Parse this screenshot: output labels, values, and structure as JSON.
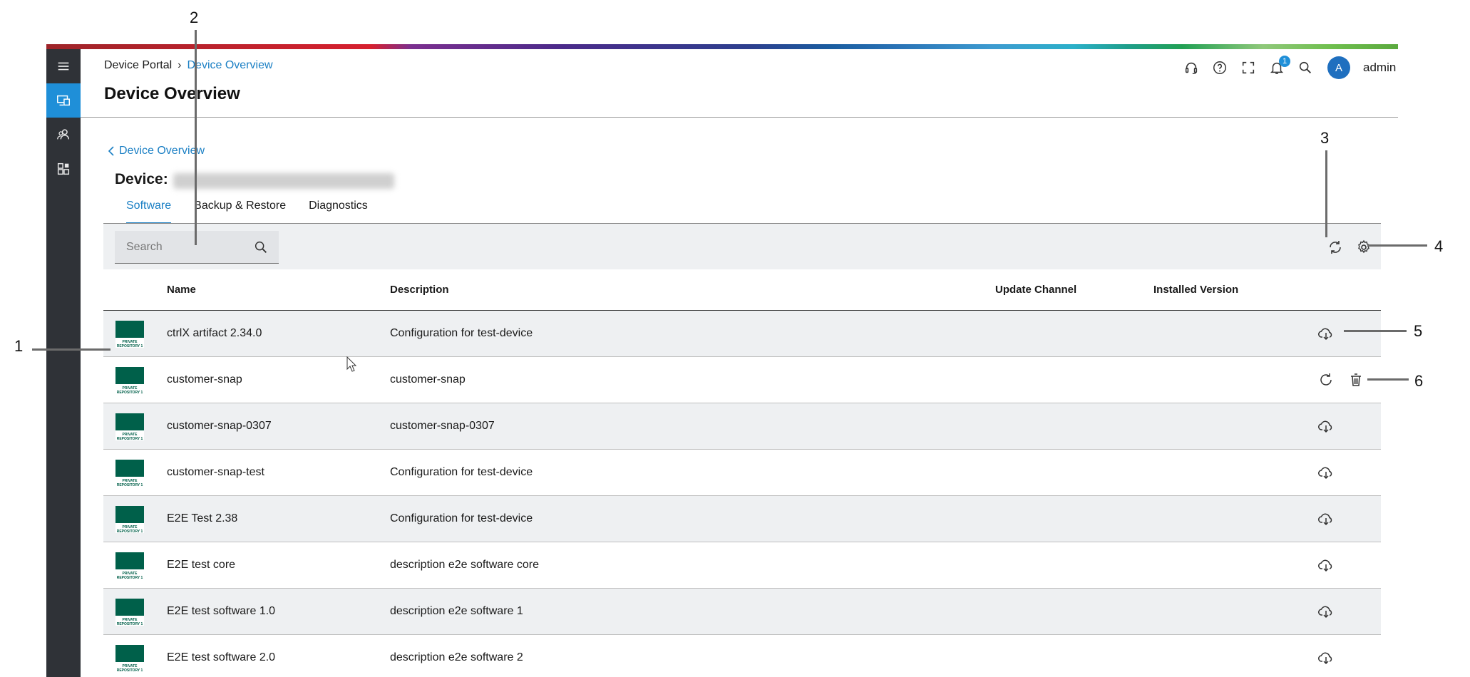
{
  "breadcrumb": {
    "root": "Device Portal",
    "separator": "›",
    "current": "Device Overview"
  },
  "page_title": "Device Overview",
  "top_actions": {
    "icons": [
      "headset-icon",
      "help-icon",
      "fullscreen-icon",
      "bell-icon",
      "search-icon"
    ],
    "notification_count": "1",
    "avatar_initial": "A",
    "username": "admin"
  },
  "rail": {
    "items": [
      "menu-icon",
      "devices-icon",
      "users-icon",
      "apps-icon"
    ],
    "active_index": 1
  },
  "device": {
    "back_label": "Device Overview",
    "label": "Device:"
  },
  "tabs": [
    {
      "label": "Software",
      "active": true
    },
    {
      "label": "Backup & Restore",
      "active": false
    },
    {
      "label": "Diagnostics",
      "active": false
    }
  ],
  "search": {
    "placeholder": "Search"
  },
  "table": {
    "columns": [
      "Name",
      "Description",
      "Update Channel",
      "Installed Version"
    ],
    "thumbnail_text": "PRIVATE REPOSITORY 1",
    "rows": [
      {
        "name": "ctrlX artifact 2.34.0",
        "description": "Configuration for test-device",
        "actions": [
          "download-icon"
        ]
      },
      {
        "name": "customer-snap",
        "description": "customer-snap",
        "actions": [
          "refresh-icon",
          "trash-icon"
        ]
      },
      {
        "name": "customer-snap-0307",
        "description": "customer-snap-0307",
        "actions": [
          "download-icon"
        ]
      },
      {
        "name": "customer-snap-test",
        "description": "Configuration for test-device",
        "actions": [
          "download-icon"
        ]
      },
      {
        "name": "E2E Test 2.38",
        "description": "Configuration for test-device",
        "actions": [
          "download-icon"
        ]
      },
      {
        "name": "E2E test core",
        "description": "description e2e software core",
        "actions": [
          "download-icon"
        ]
      },
      {
        "name": "E2E test software 1.0",
        "description": "description e2e software 1",
        "actions": [
          "download-icon"
        ]
      },
      {
        "name": "E2E test software 2.0",
        "description": "description e2e software 2",
        "actions": [
          "download-icon"
        ]
      }
    ]
  },
  "callouts": [
    "1",
    "2",
    "3",
    "4",
    "5",
    "6"
  ],
  "colors": {
    "accent": "#1a7fc4",
    "rail": "#2f3237",
    "rail_active": "#1f8fd8",
    "thumbnail": "#00604a"
  }
}
